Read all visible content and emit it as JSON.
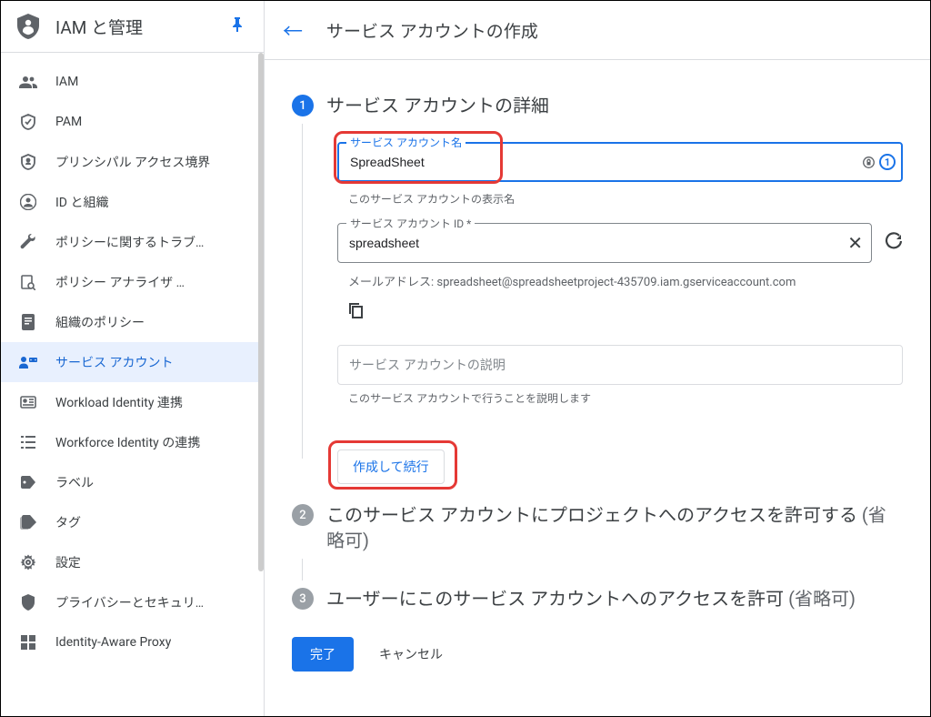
{
  "sidebar": {
    "title": "IAM と管理",
    "items": [
      {
        "label": "IAM"
      },
      {
        "label": "PAM"
      },
      {
        "label": "プリンシパル アクセス境界"
      },
      {
        "label": "ID と組織"
      },
      {
        "label": "ポリシーに関するトラブ…"
      },
      {
        "label": "ポリシー アナライザ …"
      },
      {
        "label": "組織のポリシー"
      },
      {
        "label": "サービス アカウント"
      },
      {
        "label": "Workload Identity 連携"
      },
      {
        "label": "Workforce Identity の連携"
      },
      {
        "label": "ラベル"
      },
      {
        "label": "タグ"
      },
      {
        "label": "設定"
      },
      {
        "label": "プライバシーとセキュリ…"
      },
      {
        "label": "Identity-Aware Proxy"
      }
    ]
  },
  "header": {
    "title": "サービス アカウントの作成"
  },
  "step1": {
    "title": "サービス アカウントの詳細",
    "name_label": "サービス アカウント名",
    "name_value": "SpreadSheet",
    "name_help": "このサービス アカウントの表示名",
    "id_label": "サービス アカウント ID *",
    "id_value": "spreadsheet",
    "email_prefix": "メールアドレス: ",
    "email_value": "spreadsheet@spreadsheetproject-435709.iam.gserviceaccount.com",
    "desc_placeholder": "サービス アカウントの説明",
    "desc_help": "このサービス アカウントで行うことを説明します",
    "create_continue": "作成して続行"
  },
  "step2": {
    "title_a": "このサービス アカウントにプロジェクトへのアクセスを許可する ",
    "title_b": "(省略可)"
  },
  "step3": {
    "title_a": "ユーザーにこのサービス アカウントへのアクセスを許可 ",
    "title_b": "(省略可)"
  },
  "footer": {
    "done": "完了",
    "cancel": "キャンセル"
  },
  "icons": {
    "onepass": "1"
  }
}
